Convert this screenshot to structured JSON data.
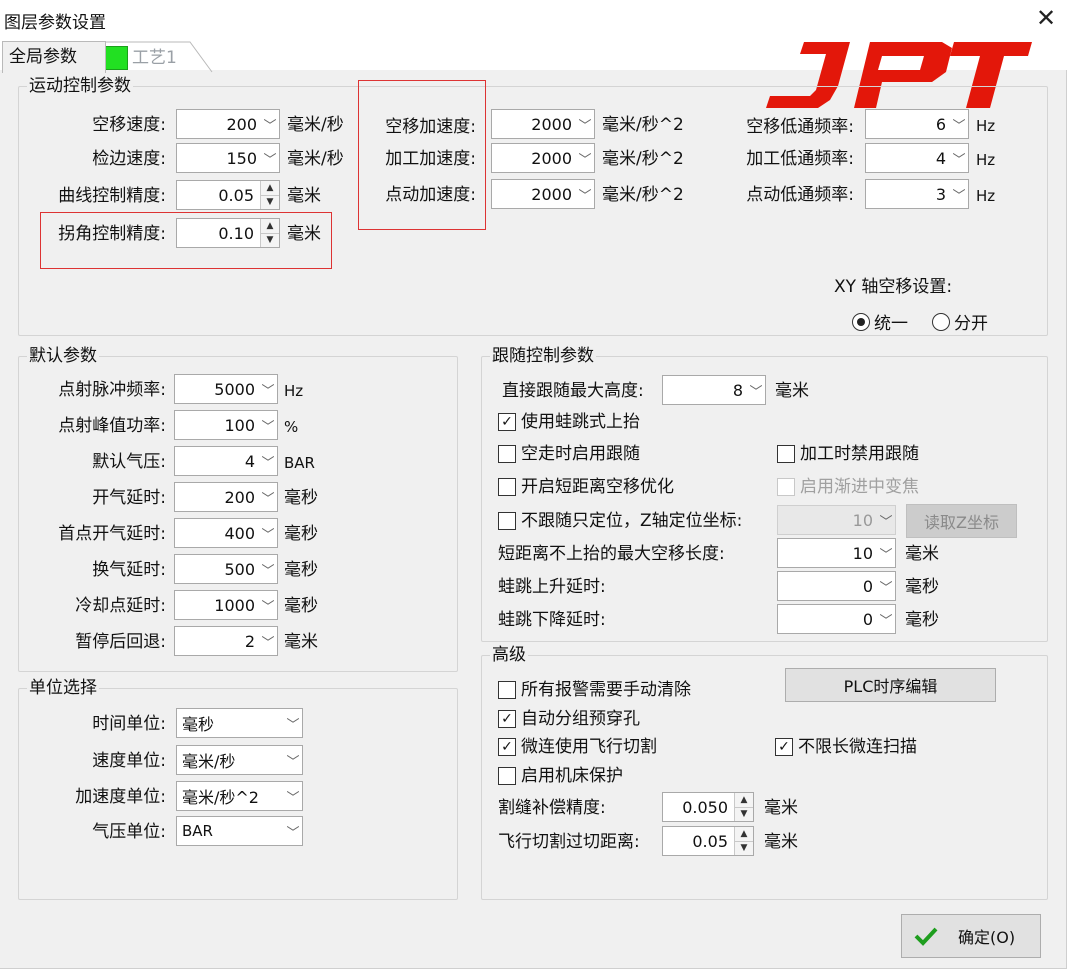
{
  "window": {
    "title": "图层参数设置",
    "close_icon": "close-icon"
  },
  "tabs": [
    {
      "label": "全局参数"
    },
    {
      "label": "工艺1",
      "swatch_color": "#22e022"
    }
  ],
  "logo": {
    "text": "JPT",
    "color": "#e3170a"
  },
  "motion": {
    "title": "运动控制参数",
    "speed": [
      {
        "label": "空移速度:",
        "value": "200",
        "unit": "毫米/秒"
      },
      {
        "label": "检边速度:",
        "value": "150",
        "unit": "毫米/秒"
      }
    ],
    "curve_precision": {
      "label": "曲线控制精度:",
      "value": "0.05",
      "unit": "毫米"
    },
    "corner_precision": {
      "label": "拐角控制精度:",
      "value": "0.10",
      "unit": "毫米"
    },
    "accel": [
      {
        "label": "空移加速度:",
        "value": "2000",
        "unit": "毫米/秒^2"
      },
      {
        "label": "加工加速度:",
        "value": "2000",
        "unit": "毫米/秒^2"
      },
      {
        "label": "点动加速度:",
        "value": "2000",
        "unit": "毫米/秒^2"
      }
    ],
    "lowpass": [
      {
        "label": "空移低通频率:",
        "value": "6",
        "unit": "Hz"
      },
      {
        "label": "加工低通频率:",
        "value": "4",
        "unit": "Hz"
      },
      {
        "label": "点动低通频率:",
        "value": "3",
        "unit": "Hz"
      }
    ],
    "xy": {
      "label": "XY 轴空移设置:",
      "options": [
        "统一",
        "分开"
      ],
      "selected": "统一"
    }
  },
  "defaults": {
    "title": "默认参数",
    "rows": [
      {
        "label": "点射脉冲频率:",
        "value": "5000",
        "unit": "Hz"
      },
      {
        "label": "点射峰值功率:",
        "value": "100",
        "unit": "%"
      },
      {
        "label": "默认气压:",
        "value": "4",
        "unit": "BAR"
      },
      {
        "label": "开气延时:",
        "value": "200",
        "unit": "毫秒"
      },
      {
        "label": "首点开气延时:",
        "value": "400",
        "unit": "毫秒"
      },
      {
        "label": "换气延时:",
        "value": "500",
        "unit": "毫秒"
      },
      {
        "label": "冷却点延时:",
        "value": "1000",
        "unit": "毫秒"
      },
      {
        "label": "暂停后回退:",
        "value": "2",
        "unit": "毫米"
      }
    ]
  },
  "follow": {
    "title": "跟随控制参数",
    "max_height": {
      "label": "直接跟随最大高度:",
      "value": "8",
      "unit": "毫米"
    },
    "checks": [
      {
        "label": "使用蛙跳式上抬",
        "checked": true,
        "disabled": false
      },
      {
        "label": "空走时启用跟随",
        "checked": false,
        "disabled": false
      },
      {
        "label": "加工时禁用跟随",
        "checked": false,
        "disabled": false
      },
      {
        "label": "开启短距离空移优化",
        "checked": false,
        "disabled": false
      },
      {
        "label": "启用渐进中变焦",
        "checked": false,
        "disabled": true
      },
      {
        "label": "不跟随只定位，Z轴定位坐标:",
        "checked": false,
        "disabled": false
      }
    ],
    "z_value": "10",
    "read_z_button": "读取Z坐标",
    "rows": [
      {
        "label": "短距离不上抬的最大空移长度:",
        "value": "10",
        "unit": "毫米"
      },
      {
        "label": "蛙跳上升延时:",
        "value": "0",
        "unit": "毫秒"
      },
      {
        "label": "蛙跳下降延时:",
        "value": "0",
        "unit": "毫秒"
      }
    ]
  },
  "units": {
    "title": "单位选择",
    "rows": [
      {
        "label": "时间单位:",
        "value": "毫秒"
      },
      {
        "label": "速度单位:",
        "value": "毫米/秒"
      },
      {
        "label": "加速度单位:",
        "value": "毫米/秒^2"
      },
      {
        "label": "气压单位:",
        "value": "BAR"
      }
    ]
  },
  "advanced": {
    "title": "高级",
    "checks": [
      {
        "label": "所有报警需要手动清除",
        "checked": false
      },
      {
        "label": "自动分组预穿孔",
        "checked": true
      },
      {
        "label": "微连使用飞行切割",
        "checked": true
      },
      {
        "label": "不限长微连扫描",
        "checked": true
      },
      {
        "label": "启用机床保护",
        "checked": false
      }
    ],
    "plc_button": "PLC时序编辑",
    "kerf": {
      "label": "割缝补偿精度:",
      "value": "0.050",
      "unit": "毫米"
    },
    "overcut": {
      "label": "飞行切割过切距离:",
      "value": "0.05",
      "unit": "毫米"
    }
  },
  "ok_button": {
    "label": "确定(O)",
    "icon": "check-icon",
    "icon_color": "#1e9e1e"
  }
}
